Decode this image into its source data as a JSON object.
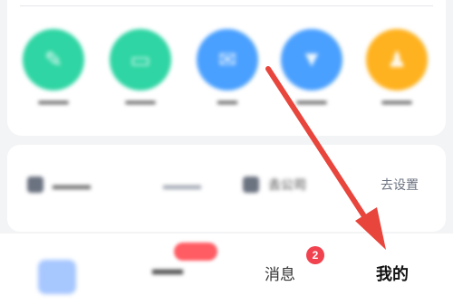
{
  "quick_actions": [
    {
      "label": "",
      "color": "#2fd5a4",
      "icon": "clipboard-icon"
    },
    {
      "label": "",
      "color": "#2fd5a4",
      "icon": "inbox-icon"
    },
    {
      "label": "",
      "color": "#4aa0ff",
      "icon": "mail-icon"
    },
    {
      "label": "",
      "color": "#4aa0ff",
      "icon": "shield-icon"
    },
    {
      "label": "",
      "color": "#ffb21f",
      "icon": "user-icon"
    }
  ],
  "settings_row": {
    "company_label": "去公司",
    "set_link": "去设置"
  },
  "bottom_nav": {
    "messages_label": "消息",
    "messages_badge": "2",
    "mine_label": "我的"
  },
  "annotation": {
    "arrow_color": "#e8453c"
  }
}
